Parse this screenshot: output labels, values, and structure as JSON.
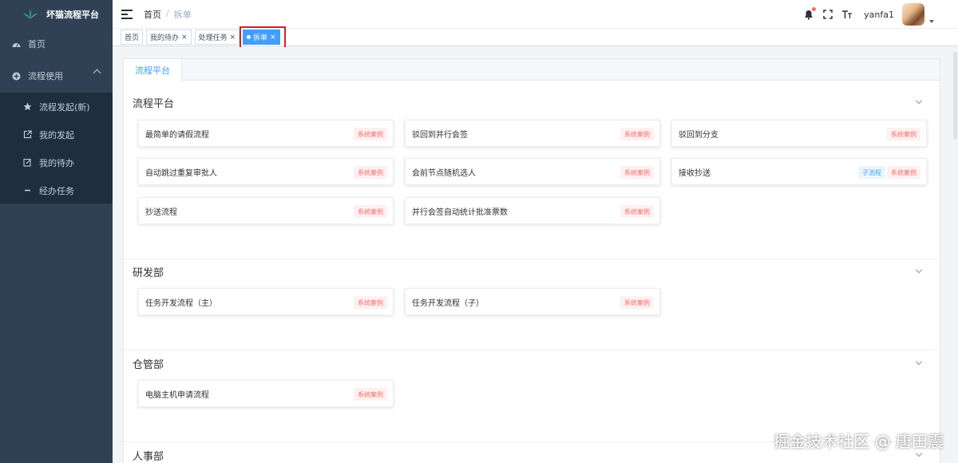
{
  "app": {
    "title": "坏猫流程平台"
  },
  "sidebar": {
    "home": "首页",
    "group": "流程使用",
    "items": [
      {
        "label": "流程发起(新)",
        "icon": "star-icon"
      },
      {
        "label": "我的发起",
        "icon": "external-link-icon"
      },
      {
        "label": "我的待办",
        "icon": "edit-icon"
      },
      {
        "label": "经办任务",
        "icon": "dash-icon"
      }
    ]
  },
  "navbar": {
    "breadcrumb": {
      "home": "首页",
      "separator": "/",
      "current": "拆单"
    },
    "username": "yanfa1"
  },
  "tags": [
    {
      "label": "首页",
      "closable": false,
      "active": false
    },
    {
      "label": "我的待办",
      "closable": true,
      "active": false
    },
    {
      "label": "处理任务",
      "closable": true,
      "active": false
    },
    {
      "label": "拆单",
      "closable": true,
      "active": true
    }
  ],
  "panel": {
    "tab": "流程平台"
  },
  "badges": {
    "system": "系统案例",
    "sub": "子流程"
  },
  "sections": [
    {
      "title": "流程平台",
      "cards": [
        {
          "name": "最简单的请假流程",
          "sub": false
        },
        {
          "name": "驳回到并行会签",
          "sub": false
        },
        {
          "name": "驳回到分支",
          "sub": false
        },
        {
          "name": "自动跳过重复审批人",
          "sub": false
        },
        {
          "name": "会前节点随机选人",
          "sub": false
        },
        {
          "name": "接收抄送",
          "sub": true
        },
        {
          "name": "抄送流程",
          "sub": false
        },
        {
          "name": "并行会签自动统计批准票数",
          "sub": false
        }
      ]
    },
    {
      "title": "研发部",
      "cards": [
        {
          "name": "任务开发流程（主）",
          "sub": false
        },
        {
          "name": "任务开发流程（子）",
          "sub": false
        }
      ]
    },
    {
      "title": "仓管部",
      "cards": [
        {
          "name": "电脑主机申请流程",
          "sub": false
        }
      ]
    },
    {
      "title": "人事部",
      "cards": []
    }
  ],
  "watermark": "掘金技术社区 @ 唐田震",
  "colors": {
    "sidebar": "#304156",
    "accent": "#409eff",
    "badge_system": "#f56c6c",
    "highlight": "#d0202a"
  }
}
